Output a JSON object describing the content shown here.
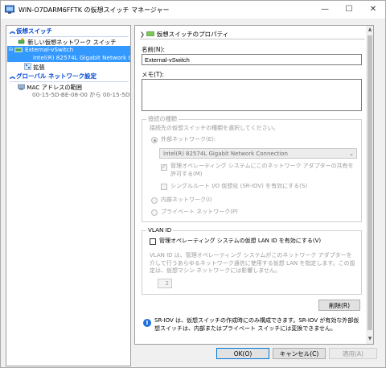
{
  "window": {
    "title": "WIN-O7DARM6FFTK の仮想スイッチ マネージャー",
    "min_glyph": "—",
    "max_glyph": "☐",
    "close_glyph": "✕"
  },
  "left_pane": {
    "section_virtual_switches": "仮想スイッチ",
    "new_switch": "新しい仮想ネットワーク スイッチ",
    "switch_name": "External-vSwitch",
    "switch_adapter": "Intel(R) 82574L Gigabit Network C...",
    "extensions": "拡張",
    "section_global": "グローバル ネットワーク設定",
    "mac_range": "MAC アドレスの範囲",
    "mac_range_value": "00-15-5D-BE-08-00 から 00-15-5D-..."
  },
  "properties": {
    "header": "仮想スイッチのプロパティ",
    "name_label": "名前(N):",
    "name_value": "External-vSwitch",
    "notes_label": "メモ(T):",
    "notes_value": "",
    "connection_type_title": "接続の種類",
    "connection_type_desc": "接続先の仮想スイッチの種類を選択してください。",
    "external_network": "外部ネットワーク(E):",
    "adapter_selected": "Intel(R) 82574L Gigabit Network Connection",
    "allow_mgmt_os": "管理オペレーティング システムにこのネットワーク アダプターの共有を許可する(M)",
    "enable_sriov": "シングルルート I/O 仮想化 (SR-IOV) を有効にする(S)",
    "internal_network": "内部ネットワーク(I)",
    "private_network": "プライベート ネットワーク(P)",
    "vlan_title": "VLAN ID",
    "vlan_enable": "管理オペレーティング システムの仮想 LAN ID を有効にする(V)",
    "vlan_desc": "VLAN ID は、管理オペレーティング システムがこのネットワーク アダプターを介して行うあらゆるネットワーク通信に使用する仮想 LAN を指定します。この設定は、仮想マシン ネットワークには影響しません。",
    "vlan_value": "2",
    "remove_button": "削除(R)",
    "sriov_info": "SR-IOV は、仮想スイッチの作成時にのみ構成できます。SR-IOV が有効な外部仮想スイッチは、内部またはプライベート スイッチには変換できません。"
  },
  "footer": {
    "ok": "OK(O)",
    "cancel": "キャンセル(C)",
    "apply": "適用(A)"
  },
  "colors": {
    "selection": "#3399ff",
    "section_header": "#0046d5",
    "info_icon": "#1e6fd9"
  }
}
